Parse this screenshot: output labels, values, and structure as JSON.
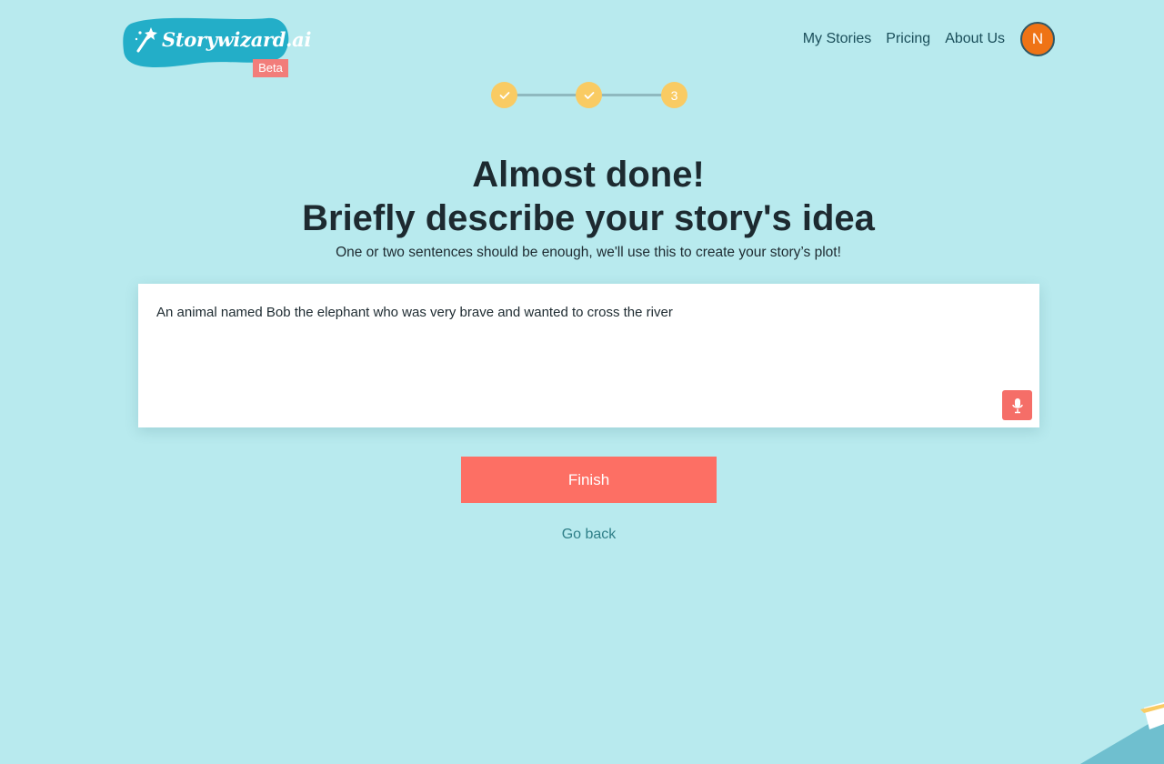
{
  "brand": {
    "name": "Storywizard.ai",
    "badge": "Beta",
    "colors": {
      "background": "#b8eaee",
      "logo_blob": "#23aec8",
      "accent": "#fd6f64",
      "step": "#f9cb63"
    }
  },
  "nav": {
    "items": [
      {
        "label": "My Stories"
      },
      {
        "label": "Pricing"
      },
      {
        "label": "About Us"
      }
    ],
    "avatar_initial": "N"
  },
  "stepper": {
    "steps": [
      {
        "state": "completed",
        "icon": "check-icon"
      },
      {
        "state": "completed",
        "icon": "check-icon"
      },
      {
        "state": "current",
        "label": "3"
      }
    ]
  },
  "main": {
    "title_line1": "Almost done!",
    "title_line2": "Briefly describe your story's idea",
    "subtitle": "One or two sentences should be enough, we'll use this to create your story’s plot!",
    "story_input_value": "An animal named Bob the elephant who was very brave and wanted to cross the river",
    "mic_icon": "microphone-icon",
    "finish_label": "Finish",
    "go_back_label": "Go back"
  }
}
